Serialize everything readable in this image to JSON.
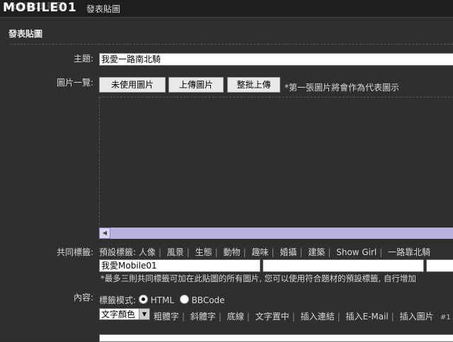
{
  "header": {
    "logo": "MOBILE01",
    "breadcrumb": "Mobile01 貼圖",
    "current_page": "發表貼圖"
  },
  "panel_title": "發表貼圖",
  "subject": {
    "label": "主題:",
    "value": "我愛一路南北騎"
  },
  "images": {
    "label": "圖片一覽:",
    "buttons": [
      "未使用圖片",
      "上傳圖片",
      "整批上傳"
    ],
    "note": "*第一張圖片將會作為代表圖示"
  },
  "tags": {
    "label": "共同標籤:",
    "preset_label": "預設標籤:",
    "preset": [
      "人像",
      "風景",
      "生態",
      "動物",
      "趣味",
      "婚攝",
      "建築",
      "Show Girl",
      "一路靠北騎"
    ],
    "inputs": [
      "我愛Mobile01",
      "",
      ""
    ],
    "note": "*最多三則共同標籤可加在此貼圖的所有圖片, 您可以使用符合題材的預設標籤, 自行增加"
  },
  "content": {
    "label": "內容:",
    "mode_label": "標籤模式:",
    "modes": [
      "HTML",
      "BBCode"
    ],
    "selected_mode": "HTML",
    "color_select": "文字顏色",
    "toolbar": [
      "粗體字",
      "斜體字",
      "底線",
      "文字置中",
      "插入連結",
      "插入E-Mail",
      "插入圖片"
    ]
  },
  "page_marker": "#1"
}
